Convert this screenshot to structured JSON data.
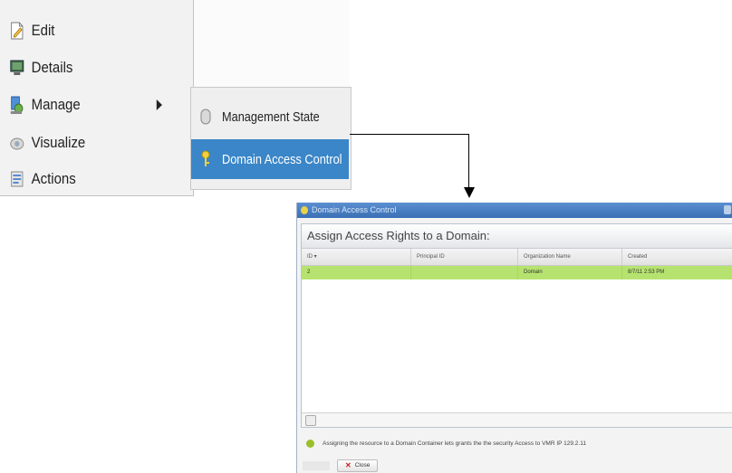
{
  "context_menu": {
    "items": [
      {
        "label": "Edit",
        "icon": "edit-icon"
      },
      {
        "label": "Details",
        "icon": "details-icon"
      },
      {
        "label": "Manage",
        "icon": "manage-icon"
      },
      {
        "label": "Visualize",
        "icon": "visualize-icon"
      },
      {
        "label": "Actions",
        "icon": "actions-icon"
      }
    ]
  },
  "submenu": {
    "items": [
      {
        "label": "Management State",
        "icon": "management-state-icon"
      },
      {
        "label": "Domain Access Control",
        "icon": "key-icon",
        "selected": true
      }
    ]
  },
  "dialog": {
    "title": "Domain Access Control",
    "panel_title": "Assign Access Rights to a Domain:",
    "columns": [
      "ID",
      "Principal ID",
      "Organization Name",
      "Created"
    ],
    "rows": [
      [
        "2",
        "",
        "Domain",
        "8/7/11 2:53 PM"
      ]
    ],
    "info_text": "Assigning the resource to a Domain Container lets grants the the security Access to VMR IP 129.2.11",
    "close_label": "Close"
  },
  "colors": {
    "selected_row": "#b6e36f",
    "menu_selected": "#3a86c8",
    "titlebar": "#3b6fb5"
  }
}
